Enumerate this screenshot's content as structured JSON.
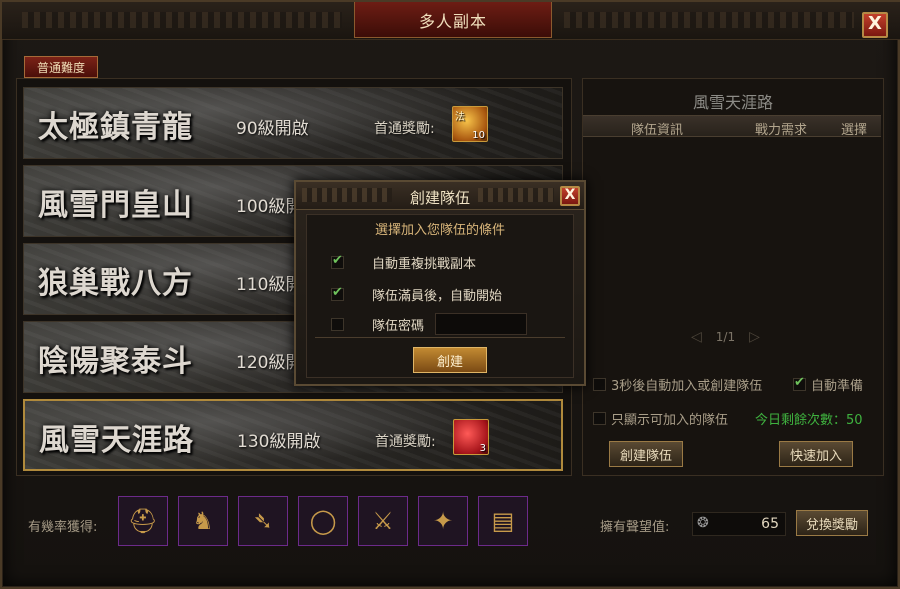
{
  "window": {
    "title": "多人副本",
    "close_label": "X"
  },
  "tab": {
    "label": "普通難度"
  },
  "dungeons": [
    {
      "name": "太極鎮青龍",
      "level": "90級開啟",
      "reward_label": "首通獎勵:",
      "reward_tag": "法",
      "reward_qty": "10",
      "reward_color": "#f8c44a"
    },
    {
      "name": "風雪門皇山",
      "level": "100級開",
      "reward_label": "",
      "reward_tag": "",
      "reward_qty": ""
    },
    {
      "name": "狼巢戰八方",
      "level": "110級開",
      "reward_label": "",
      "reward_tag": "",
      "reward_qty": ""
    },
    {
      "name": "陰陽聚泰斗",
      "level": "120級開",
      "reward_label": "",
      "reward_tag": "",
      "reward_qty": ""
    },
    {
      "name": "風雪天涯路",
      "level": "130級開啟",
      "reward_label": "首通獎勵:",
      "reward_tag": "",
      "reward_qty": "3",
      "reward_color": "#ff5a57"
    }
  ],
  "right_panel": {
    "title": "風雪天涯路",
    "columns": [
      "隊伍資訊",
      "戰力需求",
      "選擇"
    ],
    "pager": {
      "prev_icon": "triangle-left-icon",
      "page": "1/1",
      "next_icon": "triangle-right-icon"
    },
    "auto_join_label": "3秒後自動加入或創建隊伍",
    "auto_ready_label": "自動準備",
    "show_joinable_label": "只顯示可加入的隊伍",
    "remaining": "今日剩餘次數：50",
    "create_team_label": "創建隊伍",
    "quick_join_label": "快速加入"
  },
  "bottom": {
    "drops_label": "有幾率獲得:",
    "drops": [
      {
        "icon": "helmet-icon"
      },
      {
        "icon": "mount-icon"
      },
      {
        "icon": "dagger-icon"
      },
      {
        "icon": "ring-icon"
      },
      {
        "icon": "sword-icon"
      },
      {
        "icon": "fan-icon"
      },
      {
        "icon": "book-icon"
      }
    ],
    "fame_label": "擁有聲望值:",
    "fame_value": "65",
    "exchange_label": "兌換獎勵"
  },
  "dialog": {
    "title": "創建隊伍",
    "close_label": "X",
    "subtitle": "選擇加入您隊伍的條件",
    "opt_repeat": "自動重複挑戰副本",
    "opt_full_start": "隊伍滿員後，自動開始",
    "opt_password": "隊伍密碼",
    "password_value": "",
    "create_label": "創建"
  }
}
